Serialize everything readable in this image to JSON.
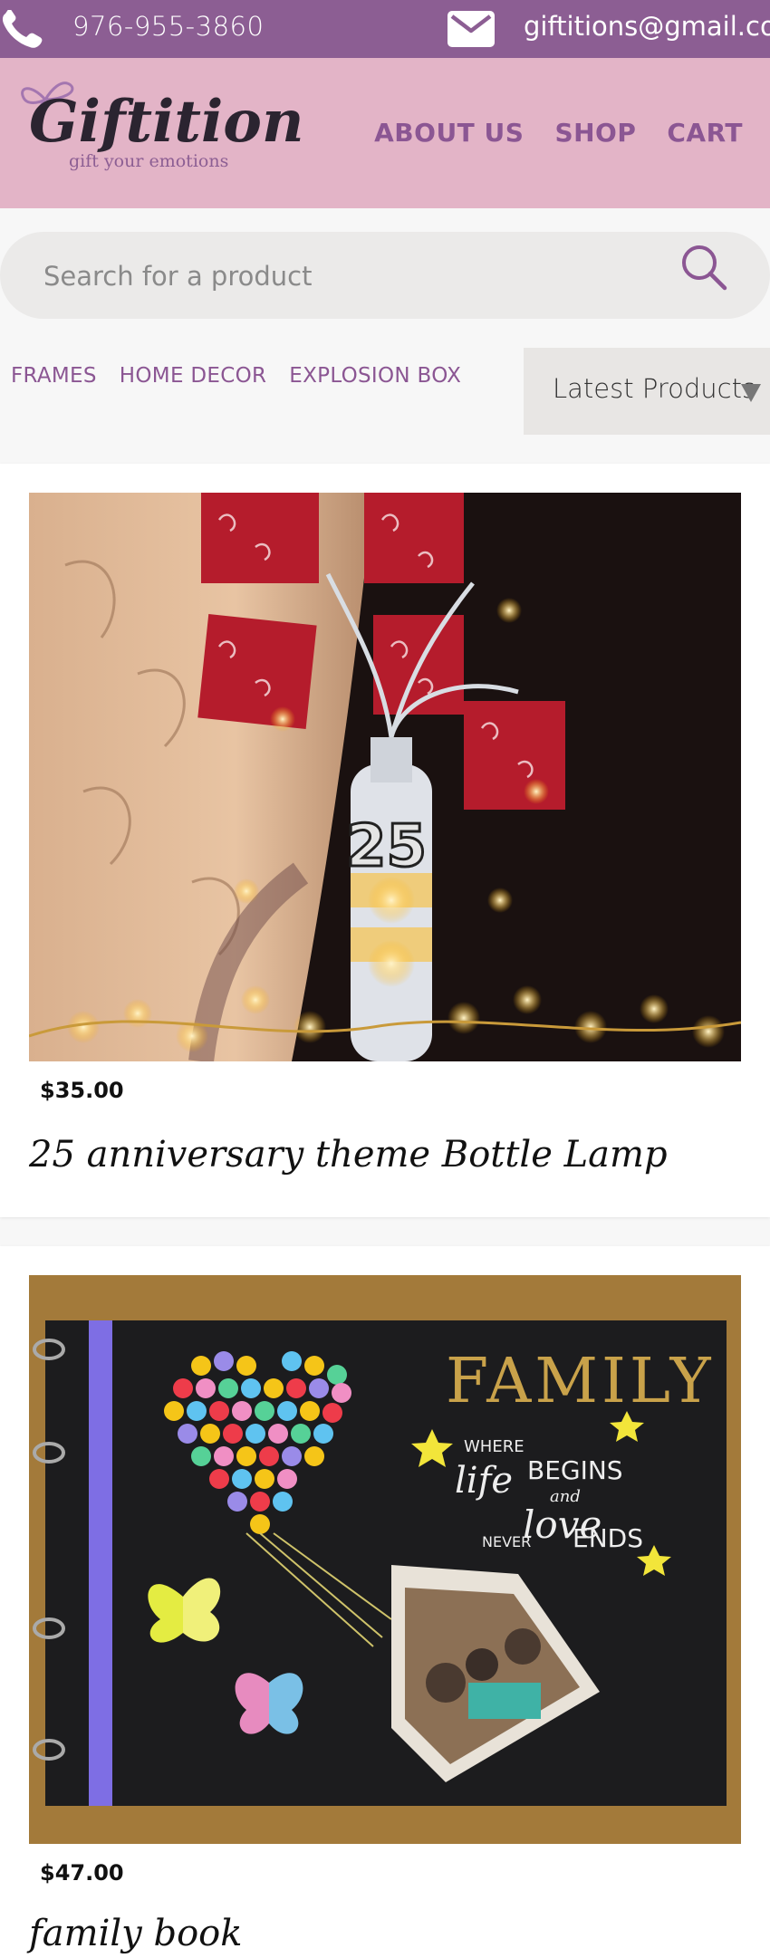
{
  "topbar": {
    "phone": "976-955-3860",
    "email": "giftitions@gmail.com",
    "phone_icon": "phone-icon",
    "mail_icon": "mail-icon"
  },
  "header": {
    "logo_text": "Giftitions",
    "logo_tagline": "gift your emotions",
    "nav": [
      "ABOUT US",
      "SHOP",
      "CART"
    ]
  },
  "search": {
    "placeholder": "Search for a product",
    "icon": "search-icon"
  },
  "categories": [
    "FRAMES",
    "HOME DECOR",
    "EXPLOSION BOX"
  ],
  "sort": {
    "selected": "Latest Products"
  },
  "products": [
    {
      "price": "$35.00",
      "title": "25 anniversary theme Bottle Lamp",
      "image_text": "25"
    },
    {
      "price": "$47.00",
      "title": "family book",
      "image_text": [
        "FAMILY",
        "WHERE",
        "life",
        "BEGINS",
        "and",
        "love",
        "NEVER",
        "ENDS"
      ]
    }
  ],
  "colors": {
    "brand_purple": "#8c5e93",
    "header_pink": "#e3b4c7",
    "nav_purple": "#8b5693"
  }
}
